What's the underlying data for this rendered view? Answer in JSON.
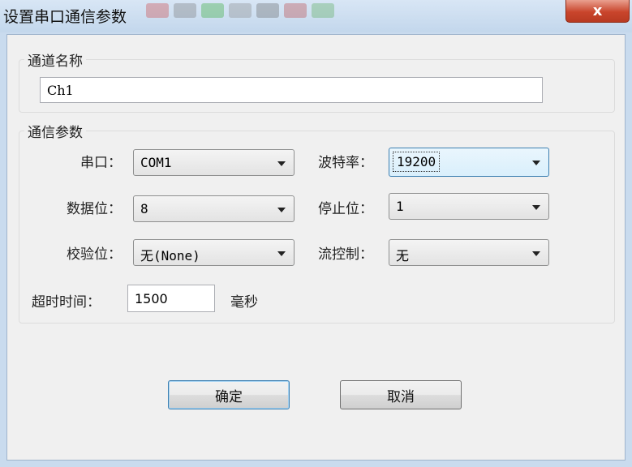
{
  "window": {
    "title": "设置串口通信参数",
    "close_symbol": "x"
  },
  "channel_group": {
    "legend": "通道名称",
    "name_value": "Ch1"
  },
  "comm_group": {
    "legend": "通信参数",
    "port": {
      "label": "串口：",
      "value": "COM1"
    },
    "baud": {
      "label": "波特率：",
      "value": "19200"
    },
    "databits": {
      "label": "数据位：",
      "value": "8"
    },
    "stopbits": {
      "label": "停止位：",
      "value": "1"
    },
    "parity": {
      "label": "校验位：",
      "value": "无(None)"
    },
    "flow": {
      "label": "流控制：",
      "value": "无"
    },
    "timeout": {
      "label": "超时时间：",
      "value": "1500",
      "unit": "毫秒"
    }
  },
  "buttons": {
    "ok": "确定",
    "cancel": "取消"
  },
  "icons": {
    "close": "close-icon",
    "dropdown": "chevron-down-icon"
  },
  "colors": {
    "title_bar": "#c9dbee",
    "close_button": "#c9452c",
    "focus_border": "#3c7fb1"
  }
}
